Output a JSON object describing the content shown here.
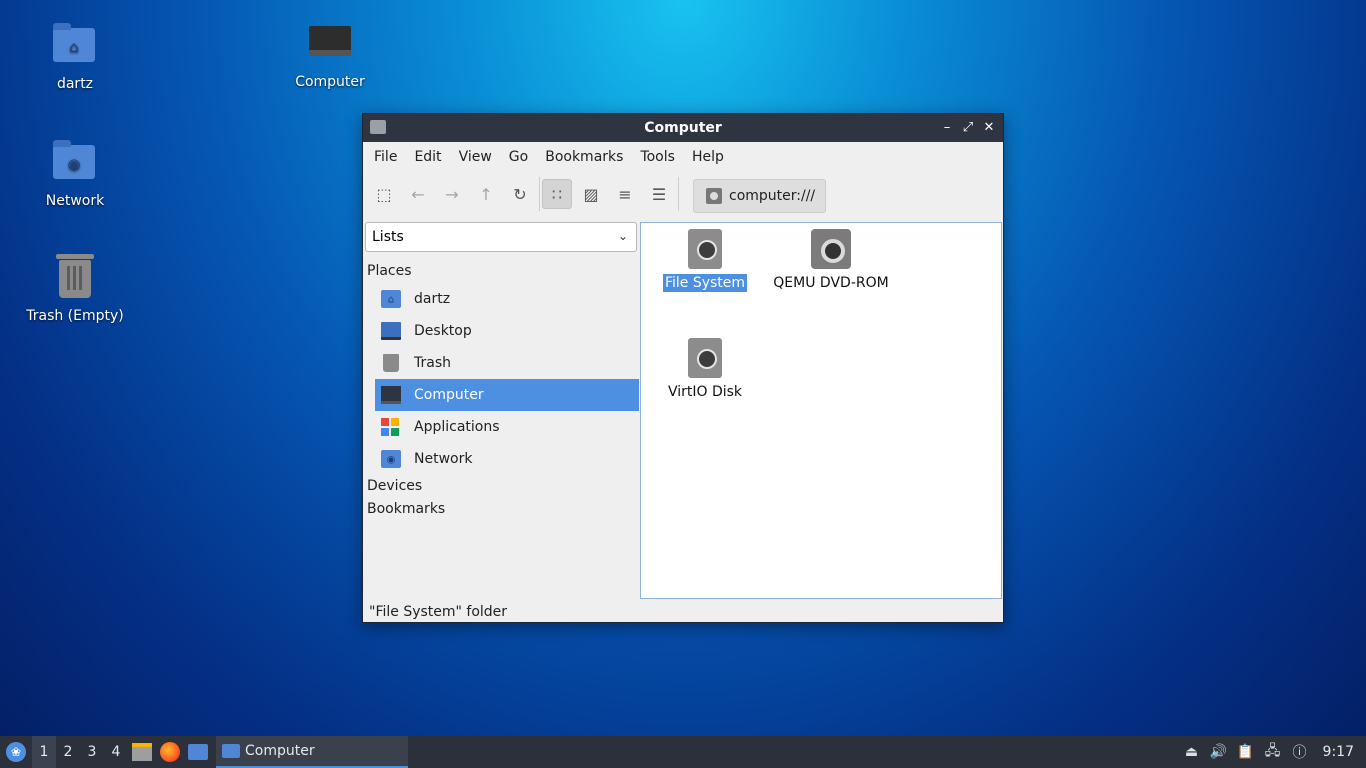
{
  "desktop": {
    "icons": [
      {
        "label": "dartz",
        "icon": "home-folder-icon"
      },
      {
        "label": "Computer",
        "icon": "computer-icon"
      },
      {
        "label": "Network",
        "icon": "network-folder-icon"
      },
      {
        "label": "Trash (Empty)",
        "icon": "trash-icon"
      }
    ]
  },
  "window": {
    "title": "Computer",
    "controls": {
      "minimize": "–",
      "maximize": "⤢",
      "close": "✕"
    },
    "menu": [
      "File",
      "Edit",
      "View",
      "Go",
      "Bookmarks",
      "Tools",
      "Help"
    ],
    "toolbar": {
      "new_window": "⬚",
      "back": "←",
      "forward": "→",
      "up": "↑",
      "reload": "↻",
      "icon_view": "∷",
      "thumb_view": "▨",
      "compact_view": "≡",
      "detail_view": "☰",
      "path": "computer:///"
    },
    "sidebar": {
      "mode": "Lists",
      "sections": {
        "places": "Places",
        "devices": "Devices",
        "bookmarks": "Bookmarks"
      },
      "places": [
        {
          "label": "dartz",
          "icon": "home-folder-icon"
        },
        {
          "label": "Desktop",
          "icon": "desktop-icon"
        },
        {
          "label": "Trash",
          "icon": "trash-icon"
        },
        {
          "label": "Computer",
          "icon": "computer-icon",
          "selected": true
        },
        {
          "label": "Applications",
          "icon": "applications-icon"
        },
        {
          "label": "Network",
          "icon": "network-folder-icon"
        }
      ]
    },
    "items": [
      {
        "label": "File System",
        "icon": "harddisk-icon",
        "selected": true
      },
      {
        "label": "QEMU DVD-ROM",
        "icon": "optical-drive-icon"
      },
      {
        "label": "VirtIO Disk",
        "icon": "harddisk-icon"
      }
    ],
    "status": "\"File System\" folder"
  },
  "taskbar": {
    "workspaces": [
      "1",
      "2",
      "3",
      "4"
    ],
    "active_workspace": "1",
    "task_label": "Computer",
    "clock": "9:17"
  },
  "colors": {
    "accent": "#4d8fe0",
    "titlebar": "#2f3540",
    "taskbar": "#2b303a"
  }
}
